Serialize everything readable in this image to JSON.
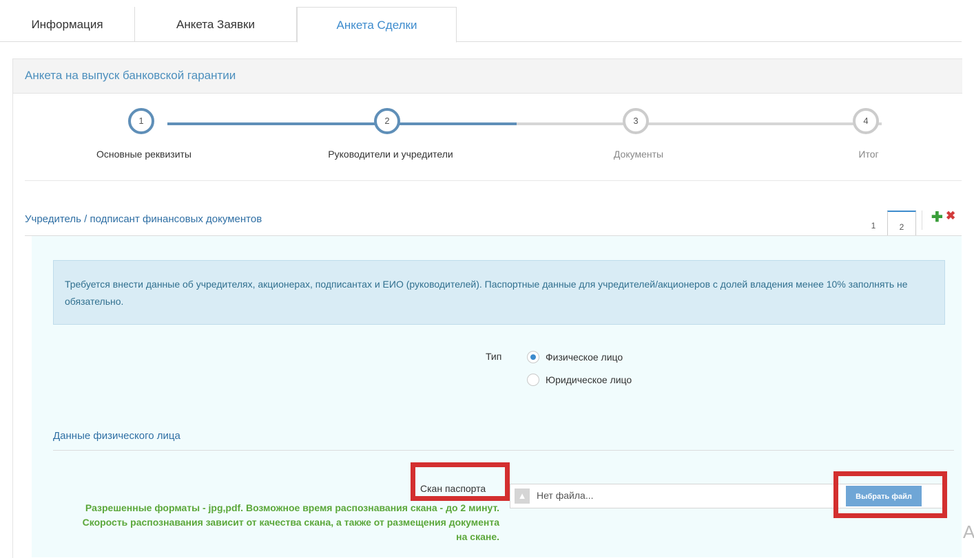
{
  "tabs": [
    {
      "label": "Информация"
    },
    {
      "label": "Анкета Заявки"
    },
    {
      "label": "Анкета Сделки"
    }
  ],
  "panel": {
    "title": "Анкета на выпуск банковской гарантии"
  },
  "wizard": {
    "steps": [
      {
        "num": "1",
        "label": "Основные реквизиты",
        "state": "done"
      },
      {
        "num": "2",
        "label": "Руководители и учредители",
        "state": "active"
      },
      {
        "num": "3",
        "label": "Документы",
        "state": "todo"
      },
      {
        "num": "4",
        "label": "Итог",
        "state": "todo"
      }
    ]
  },
  "founder": {
    "title": "Учредитель / подписант финансовых документов",
    "index_tabs": [
      "1",
      "2"
    ],
    "active_index": "2",
    "add_icon": "plus-icon",
    "remove_icon": "close-icon"
  },
  "alert": {
    "text": "Требуется внести данные об учредителях, акционерах, подписантах и ЕИО (руководителей). Паспортные данные для учредителей/акционеров с долей владения менее 10% заполнять не обязательно."
  },
  "type_field": {
    "label": "Тип",
    "options": [
      "Физическое лицо",
      "Юридическое лицо"
    ],
    "selected": "Физическое лицо"
  },
  "person_section": {
    "title": "Данные физического лица"
  },
  "scan": {
    "label": "Скан паспорта",
    "file_placeholder": "Нет файла...",
    "button": "Выбрать файл",
    "hint": "Разрешенные форматы - jpg,pdf. Возможное время распознавания скана - до 2 минут. Скорость распознавания зависит от качества скана, а также от размещения документа на скане."
  },
  "cut_text": "A",
  "colors": {
    "accent": "#3d8bcd",
    "highlight": "#d32f2f",
    "hint": "#5ba73a",
    "alert_bg": "#d9ecf5"
  }
}
